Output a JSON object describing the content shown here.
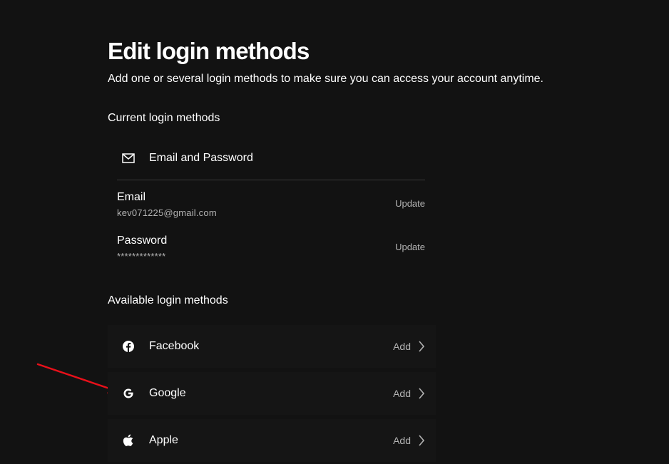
{
  "page": {
    "title": "Edit login methods",
    "subtitle": "Add one or several login methods to make sure you can access your account anytime."
  },
  "current": {
    "heading": "Current login methods",
    "method": {
      "label": "Email and Password",
      "icon": "mail-icon"
    },
    "credentials": [
      {
        "label": "Email",
        "value": "kev071225@gmail.com",
        "action": "Update"
      },
      {
        "label": "Password",
        "value": "*************",
        "action": "Update"
      }
    ]
  },
  "available": {
    "heading": "Available login methods",
    "providers": [
      {
        "name": "Facebook",
        "icon": "facebook-icon",
        "action": "Add"
      },
      {
        "name": "Google",
        "icon": "google-icon",
        "action": "Add"
      },
      {
        "name": "Apple",
        "icon": "apple-icon",
        "action": "Add"
      }
    ]
  },
  "colors": {
    "background": "#121212",
    "text": "#ffffff",
    "muted": "#b3b3b3",
    "row_background": "#151515",
    "annotation": "#e8101a"
  }
}
